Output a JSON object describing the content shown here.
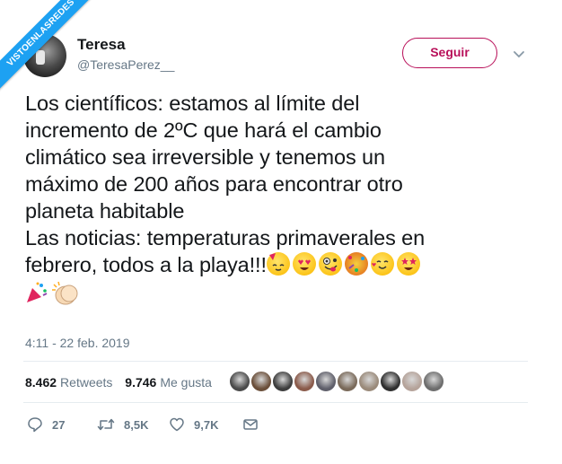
{
  "watermark": {
    "text": "VISTOENLASREDES"
  },
  "user": {
    "name": "Teresa",
    "handle": "@TeresaPerez__"
  },
  "follow_button": {
    "label": "Seguir"
  },
  "tweet": {
    "lines": [
      "Los científicos: estamos al límite del",
      "incremento de 2ºC que hará el cambio",
      "climático sea irreversible y tenemos un",
      "máximo de 200 años para encontrar otro",
      "planeta habitable",
      "Las noticias: temperaturas primaverales en",
      "febrero, todos a la playa!!!"
    ],
    "emojis_line7": [
      "partying-face",
      "heart-eyes",
      "zany-face",
      "confetti-ball",
      "smiling-hearts",
      "star-struck"
    ],
    "emojis_line8": [
      "party-popper",
      "clapping-hands"
    ]
  },
  "timestamp": "4:11 - 22 feb. 2019",
  "stats": {
    "retweets_count": "8.462",
    "retweets_label": "Retweets",
    "likes_count": "9.746",
    "likes_label": "Me gusta"
  },
  "likers": [
    "#4a4a4a",
    "#6b4f3a",
    "#3d3d3d",
    "#8a5a4a",
    "#5f5f6a",
    "#7a6a5a",
    "#9a8a7a",
    "#2f2f2f",
    "#b5a39a",
    "#6d6d6d"
  ],
  "actions": {
    "reply_count": "27",
    "retweet_count": "8,5K",
    "like_count": "9,7K"
  },
  "colors": {
    "accent": "#b80f59",
    "twitter_blue": "#1da1f2",
    "muted": "#657786"
  }
}
